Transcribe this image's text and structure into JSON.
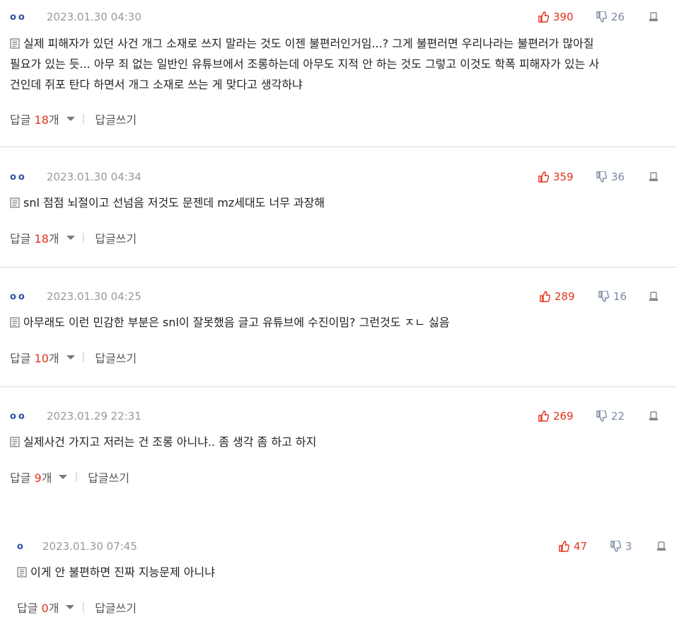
{
  "comments": [
    {
      "user_marker": "oo",
      "date": "2023.01.30 04:30",
      "likes": "390",
      "dislikes": "26",
      "text_lines": [
        "실제 피해자가 있던 사건 개그 소재로 쓰지 말라는 것도 이젠 불편러인거임...? 그게 불편러면 우리나라는 불편러가 많아질",
        "필요가 있는 듯... 아무 죄 없는 일반인 유튜브에서 조롱하는데 아무도 지적 안 하는 것도 그렇고 이것도 학폭 피해자가 있는 사",
        "건인데 쥐포 탄다 하면서 개그 소재로 쓰는 게 맞다고 생각하냐"
      ],
      "reply_label": "답글",
      "reply_count": "18",
      "reply_unit": "개",
      "write_reply": "답글쓰기"
    },
    {
      "user_marker": "oo",
      "date": "2023.01.30 04:34",
      "likes": "359",
      "dislikes": "36",
      "text_lines": [
        "snl 점점 뇌절이고 선넘음 저것도 문젠데 mz세대도 너무 과장해"
      ],
      "reply_label": "답글",
      "reply_count": "18",
      "reply_unit": "개",
      "write_reply": "답글쓰기"
    },
    {
      "user_marker": "oo",
      "date": "2023.01.30 04:25",
      "likes": "289",
      "dislikes": "16",
      "text_lines": [
        "아무래도 이런 민감한 부분은 snl이 잘못했음 글고 유튜브에 수진이밈? 그런것도 ㅈㄴ 싫음"
      ],
      "reply_label": "답글",
      "reply_count": "10",
      "reply_unit": "개",
      "write_reply": "답글쓰기"
    },
    {
      "user_marker": "oo",
      "date": "2023.01.29 22:31",
      "likes": "269",
      "dislikes": "22",
      "text_lines": [
        "실제사건 가지고 저러는 건 조롱 아니냐.. 좀 생각 좀 하고 하지"
      ],
      "reply_label": "답글",
      "reply_count": "9",
      "reply_unit": "개",
      "write_reply": "답글쓰기"
    },
    {
      "user_marker": "o",
      "date": "2023.01.30 07:45",
      "likes": "47",
      "dislikes": "3",
      "text_lines": [
        "이게 안 불편하면 진짜 지능문제 아니냐"
      ],
      "reply_label": "답글",
      "reply_count": "0",
      "reply_unit": "개",
      "write_reply": "답글쓰기"
    }
  ],
  "icons": {
    "like": "thumbs-up-icon",
    "dislike": "thumbs-down-icon",
    "report": "report-icon",
    "document": "document-icon"
  },
  "colors": {
    "like": "#e4321b",
    "dislike": "#7a8aa3",
    "user_marker": "#2c4fa3",
    "reply_count": "#e4321b"
  }
}
